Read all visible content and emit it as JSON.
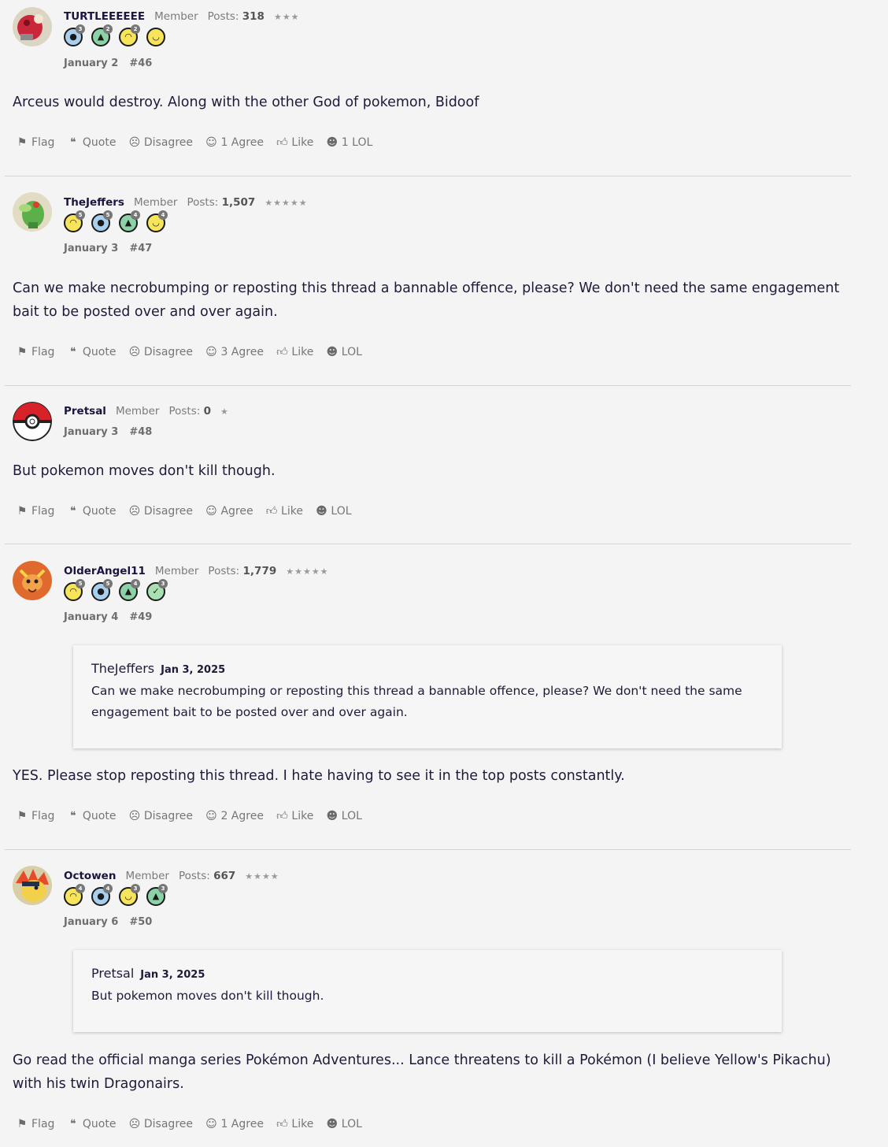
{
  "common_labels": {
    "flag": "Flag",
    "quote": "Quote",
    "disagree": "Disagree",
    "like": "Like",
    "posts_label": "Posts:"
  },
  "posts": [
    {
      "username": "TURTLEEEEEE",
      "role": "Member",
      "post_count": "318",
      "stars": "★★★",
      "date": "January 2",
      "number": "#46",
      "body": "Arceus would destroy. Along with the other God of pokemon, Bidoof",
      "badges": [
        {
          "icon": "speech-bubble-icon",
          "color": "blue",
          "level": "3"
        },
        {
          "icon": "thumbs-up-icon",
          "color": "green",
          "level": "2"
        },
        {
          "icon": "wink-face-icon",
          "color": "yellow",
          "level": "2"
        },
        {
          "icon": "laugh-face-icon",
          "color": "yellow",
          "level": ""
        }
      ],
      "agree_label": "1 Agree",
      "lol_label": "1 LOL"
    },
    {
      "username": "TheJeffers",
      "role": "Member",
      "post_count": "1,507",
      "stars": "★★★★★",
      "date": "January 3",
      "number": "#47",
      "body": "Can we make necrobumping or reposting this thread a bannable offence, please? We don't need the same engagement bait to be posted over and over again.",
      "badges": [
        {
          "icon": "wink-face-icon",
          "color": "yellow",
          "level": "5"
        },
        {
          "icon": "speech-bubble-icon",
          "color": "blue",
          "level": "5"
        },
        {
          "icon": "thumbs-up-icon",
          "color": "green",
          "level": "4"
        },
        {
          "icon": "laugh-face-icon",
          "color": "yellow",
          "level": "4"
        }
      ],
      "agree_label": "3 Agree",
      "lol_label": "LOL"
    },
    {
      "username": "Pretsal",
      "role": "Member",
      "post_count": "0",
      "stars": "★",
      "date": "January 3",
      "number": "#48",
      "body": "But pokemon moves don't kill though.",
      "badges": [],
      "agree_label": "Agree",
      "lol_label": "LOL"
    },
    {
      "username": "OlderAngel11",
      "role": "Member",
      "post_count": "1,779",
      "stars": "★★★★★",
      "date": "January 4",
      "number": "#49",
      "quote": {
        "author": "TheJeffers",
        "date": "Jan 3, 2025",
        "text": "Can we make necrobumping or reposting this thread a bannable offence, please? We don't need the same engagement bait to be posted over and over again."
      },
      "body": "YES. Please stop reposting this thread. I hate having to see it in the top posts constantly.",
      "badges": [
        {
          "icon": "wink-face-icon",
          "color": "yellow",
          "level": "5"
        },
        {
          "icon": "speech-bubble-icon",
          "color": "blue",
          "level": "5"
        },
        {
          "icon": "thumbs-up-icon",
          "color": "green",
          "level": "4"
        },
        {
          "icon": "checkmark-icon",
          "color": "green",
          "level": "3"
        }
      ],
      "agree_label": "2 Agree",
      "lol_label": "LOL"
    },
    {
      "username": "Octowen",
      "role": "Member",
      "post_count": "667",
      "stars": "★★★★",
      "date": "January 6",
      "number": "#50",
      "quote": {
        "author": "Pretsal",
        "date": "Jan 3, 2025",
        "text": "But pokemon moves don't kill though."
      },
      "body": "Go read the official manga series Pokémon Adventures... Lance threatens to kill a Pokémon (I believe Yellow's Pikachu) with his twin Dragonairs.",
      "badges": [
        {
          "icon": "wink-face-icon",
          "color": "yellow",
          "level": "4"
        },
        {
          "icon": "speech-bubble-icon",
          "color": "blue",
          "level": "4"
        },
        {
          "icon": "laugh-face-icon",
          "color": "yellow",
          "level": "3"
        },
        {
          "icon": "thumbs-up-icon",
          "color": "green",
          "level": "3"
        }
      ],
      "agree_label": "1 Agree",
      "lol_label": "LOL"
    }
  ]
}
